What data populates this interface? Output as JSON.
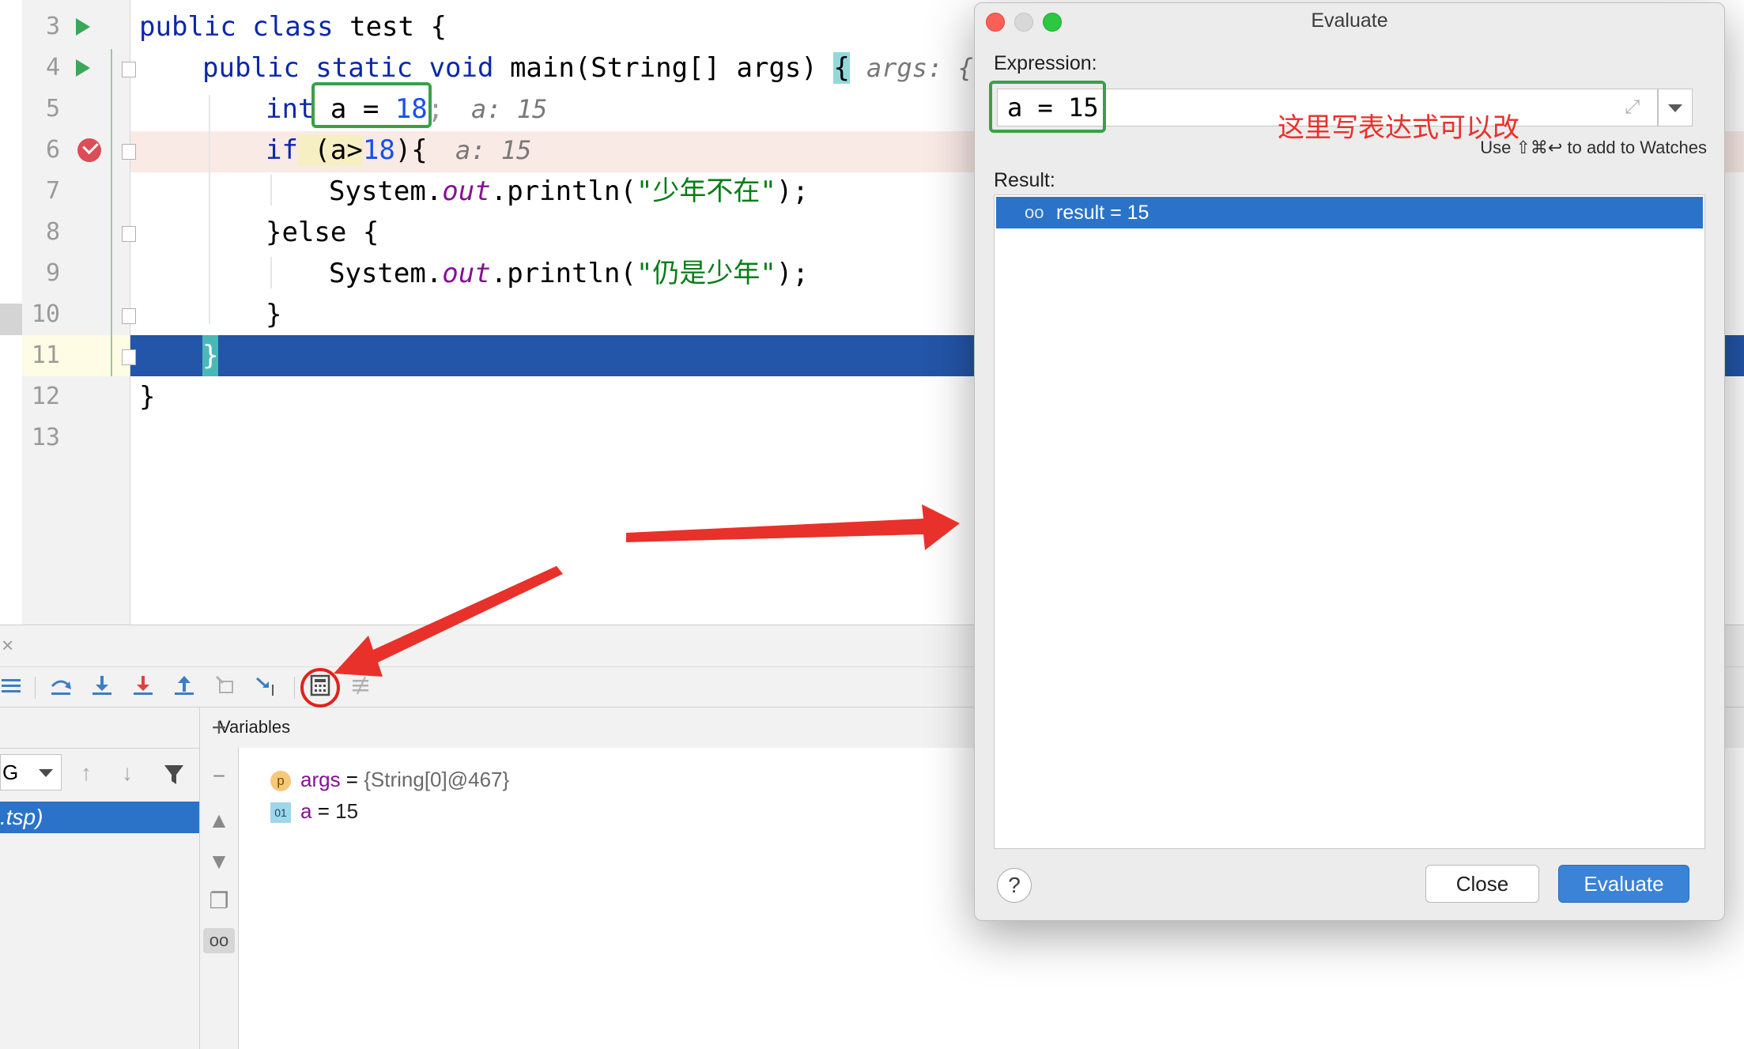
{
  "editor": {
    "lines": [
      {
        "num": "3"
      },
      {
        "num": "4"
      },
      {
        "num": "5"
      },
      {
        "num": "6"
      },
      {
        "num": "7"
      },
      {
        "num": "8"
      },
      {
        "num": "9"
      },
      {
        "num": "10"
      },
      {
        "num": "11"
      },
      {
        "num": "12"
      },
      {
        "num": "13"
      }
    ],
    "code": {
      "l3_kw": "public class",
      "l3_rest": " test {",
      "l4_kw1": "public static void",
      "l4_rest": " main(String[] args) ",
      "l4_brace": "{",
      "l4_hint": "args: {",
      "l5_kw": "int",
      "l5_rest": " a = ",
      "l5_num": "18",
      "l5_semi": ";",
      "l5_hint": "a: 15",
      "l6_kw": "if",
      "l6_a": " (a>",
      "l6_num": "18",
      "l6_rest": "){",
      "l6_hint": "a: 15",
      "l7_pre": "System.",
      "l7_out": "out",
      "l7_mid": ".println(",
      "l7_str": "\"少年不在\"",
      "l7_end": ");",
      "l8": "}else {",
      "l9_pre": "System.",
      "l9_out": "out",
      "l9_mid": ".println(",
      "l9_str": "\"仍是少年\"",
      "l9_end": ");",
      "l10": "}",
      "l11": "}",
      "l12": "}"
    }
  },
  "debug": {
    "close_glyph": "×",
    "thread_value": "G",
    "frame_label": ".tsp)",
    "variables_title": "Variables",
    "vars": [
      {
        "badge": "p",
        "name": "args",
        "eq": " = ",
        "value": "{String[0]@467}"
      },
      {
        "badge": "01",
        "name": "a",
        "eq": " = ",
        "value": "15"
      }
    ]
  },
  "dialog": {
    "title": "Evaluate",
    "expression_label": "Expression:",
    "expression_value": "a = 15",
    "hint": "Use ⇧⌘↩ to add to Watches",
    "result_label": "Result:",
    "result_value": "result = 15",
    "help_glyph": "?",
    "close_label": "Close",
    "evaluate_label": "Evaluate"
  },
  "annotation": {
    "note": "这里写表达式可以改"
  },
  "colors": {
    "accent": "#2a73c8",
    "annotation_red": "#e8312a",
    "annotation_green": "#3aa048",
    "current_line": "#2355a8"
  }
}
